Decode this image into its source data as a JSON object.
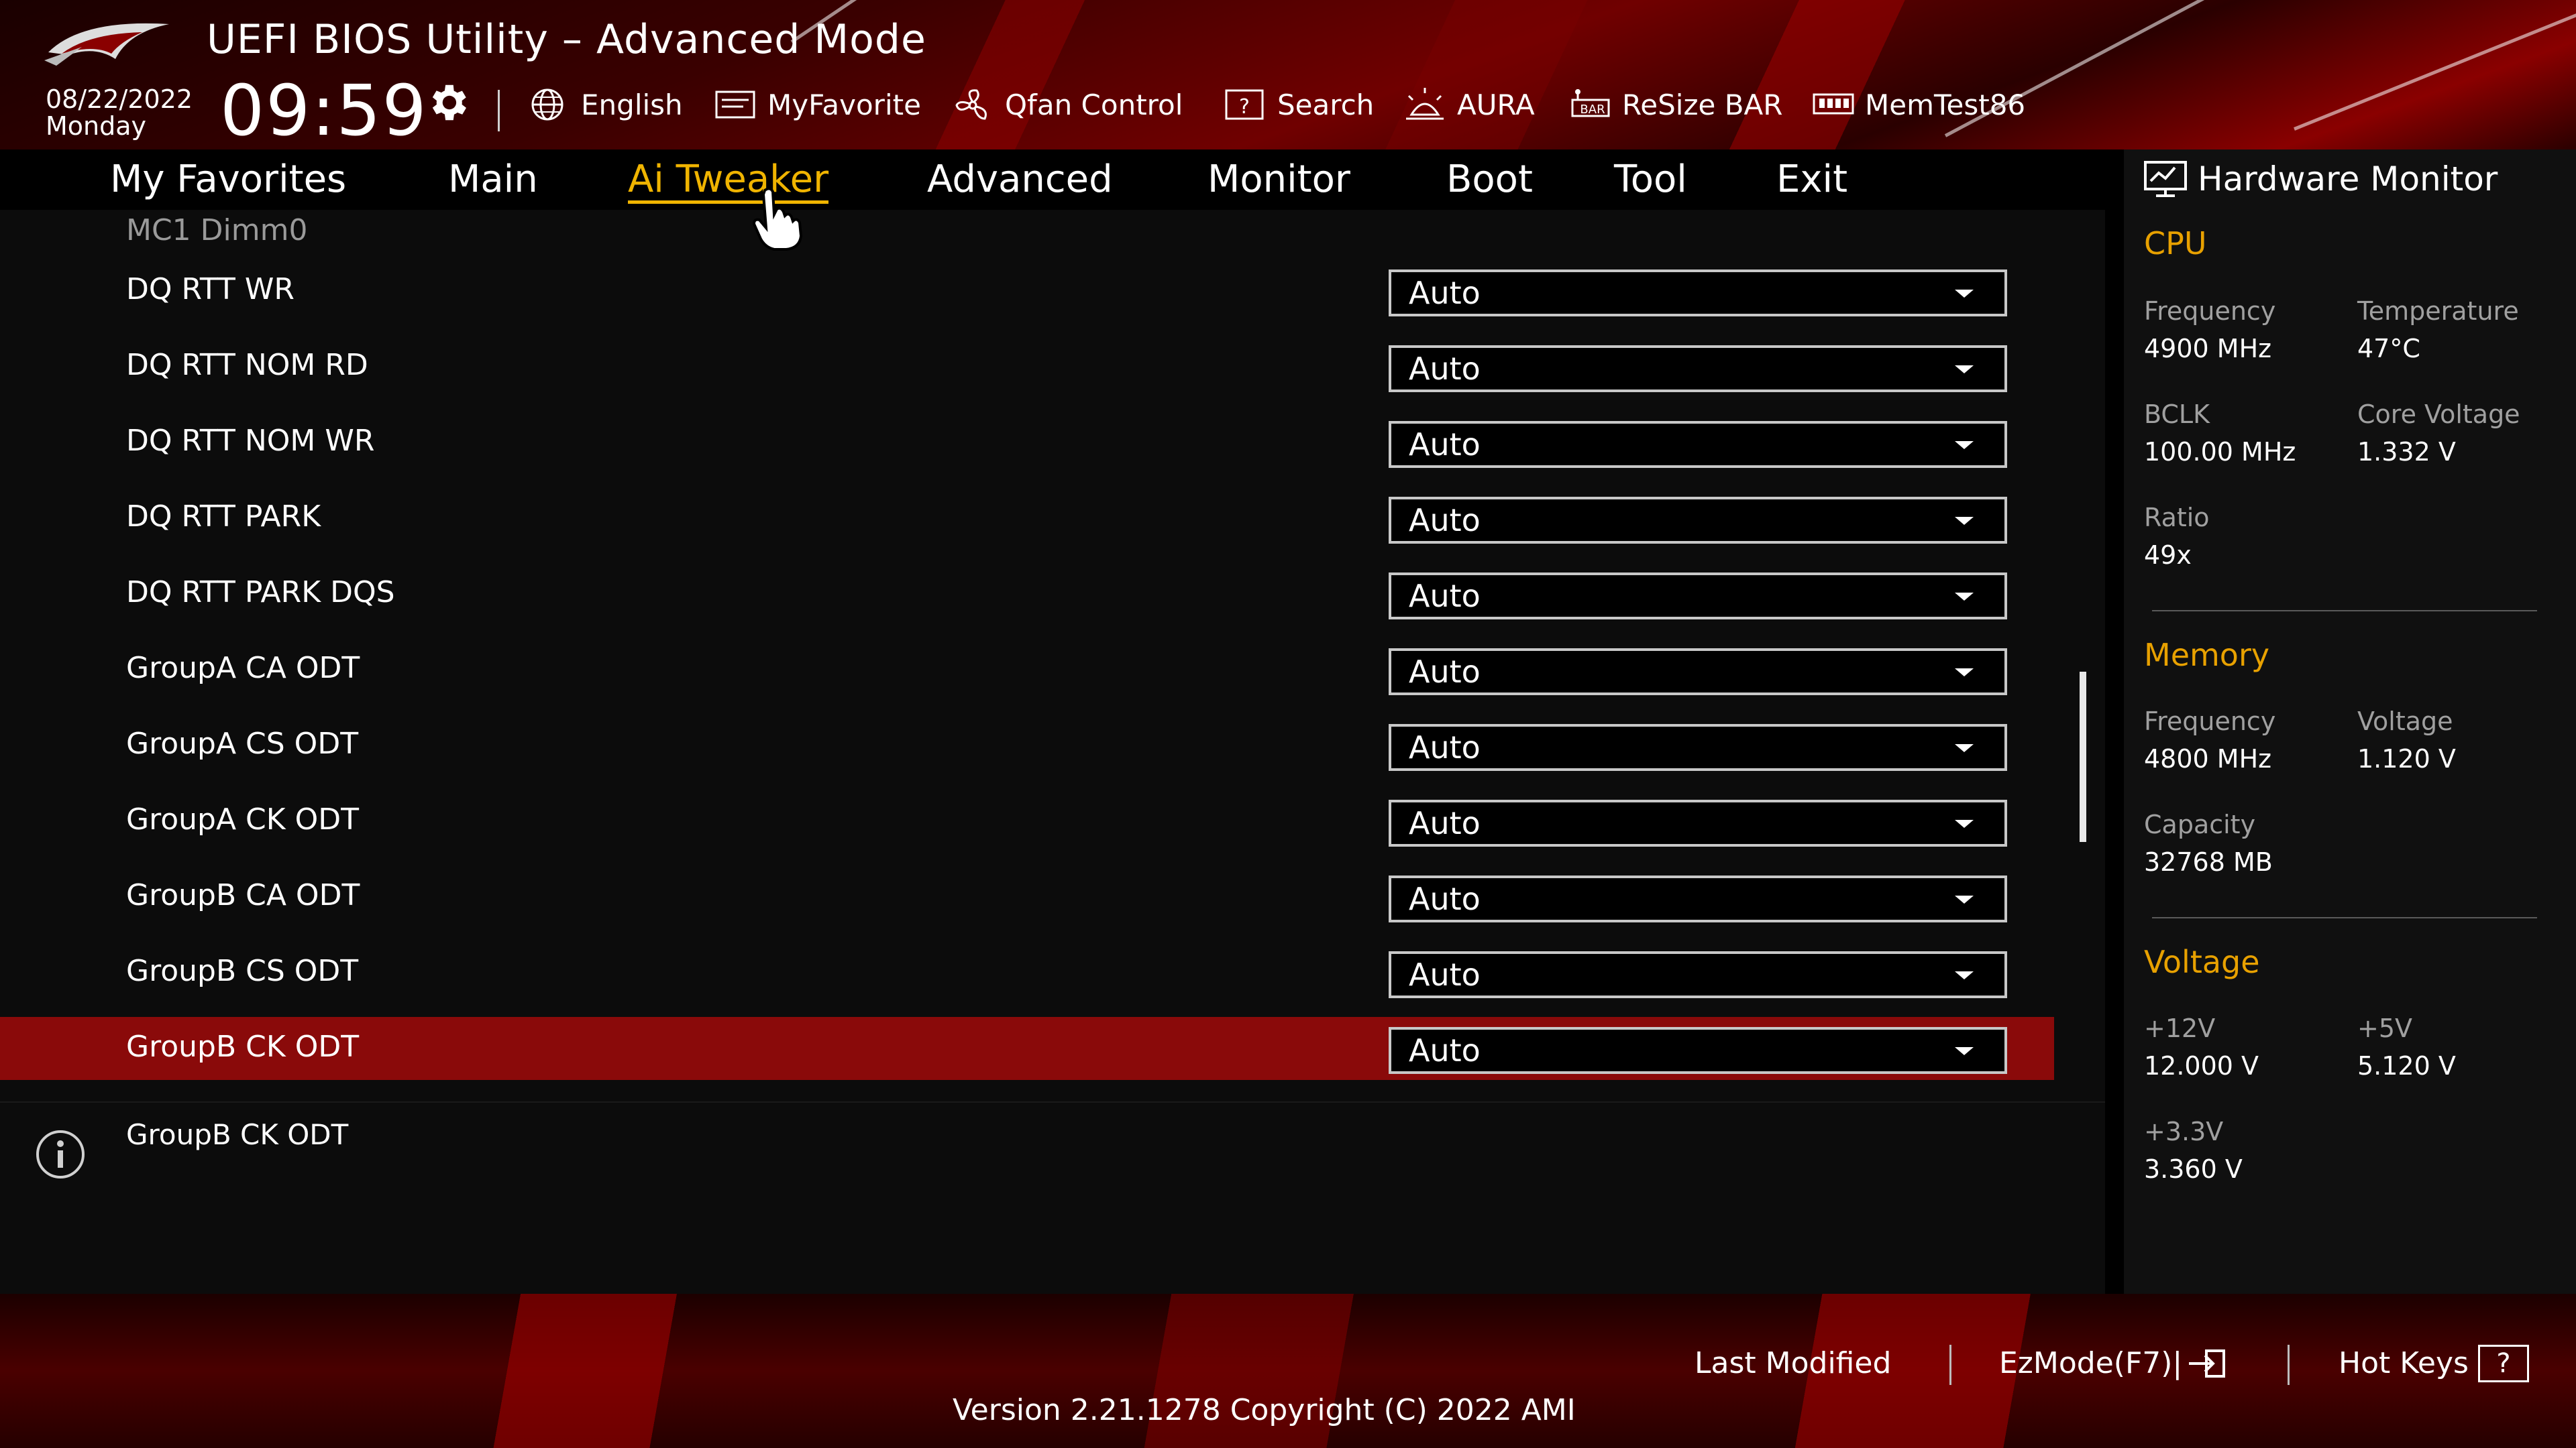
{
  "header": {
    "title": "UEFI BIOS Utility – Advanced Mode",
    "date": "08/22/2022",
    "day": "Monday",
    "time": "09:59",
    "toolbar": [
      {
        "label": "English",
        "icon": "globe-icon"
      },
      {
        "label": "MyFavorite",
        "icon": "favorite-icon"
      },
      {
        "label": "Qfan Control",
        "icon": "fan-icon"
      },
      {
        "label": "Search",
        "icon": "search-icon"
      },
      {
        "label": "AURA",
        "icon": "aura-icon"
      },
      {
        "label": "ReSize BAR",
        "icon": "resize-bar-icon"
      },
      {
        "label": "MemTest86",
        "icon": "memtest-icon"
      }
    ]
  },
  "tabs": [
    {
      "label": "My Favorites"
    },
    {
      "label": "Main"
    },
    {
      "label": "Ai Tweaker",
      "active": true
    },
    {
      "label": "Advanced"
    },
    {
      "label": "Monitor"
    },
    {
      "label": "Boot"
    },
    {
      "label": "Tool"
    },
    {
      "label": "Exit"
    }
  ],
  "main": {
    "section": "MC1 Dimm0",
    "rows": [
      {
        "label": "DQ RTT WR",
        "value": "Auto"
      },
      {
        "label": "DQ RTT NOM RD",
        "value": "Auto"
      },
      {
        "label": "DQ RTT NOM WR",
        "value": "Auto"
      },
      {
        "label": "DQ RTT PARK",
        "value": "Auto"
      },
      {
        "label": "DQ RTT PARK DQS",
        "value": "Auto"
      },
      {
        "label": "GroupA CA ODT",
        "value": "Auto"
      },
      {
        "label": "GroupA CS ODT",
        "value": "Auto"
      },
      {
        "label": "GroupA CK ODT",
        "value": "Auto"
      },
      {
        "label": "GroupB CA ODT",
        "value": "Auto"
      },
      {
        "label": "GroupB CS ODT",
        "value": "Auto"
      },
      {
        "label": "GroupB CK ODT",
        "value": "Auto",
        "selected": true
      }
    ],
    "help_text": "GroupB CK ODT"
  },
  "hardware_monitor": {
    "title": "Hardware Monitor",
    "cpu": {
      "title": "CPU",
      "frequency_label": "Frequency",
      "frequency": "4900 MHz",
      "temperature_label": "Temperature",
      "temperature": "47°C",
      "bclk_label": "BCLK",
      "bclk": "100.00 MHz",
      "core_voltage_label": "Core Voltage",
      "core_voltage": "1.332 V",
      "ratio_label": "Ratio",
      "ratio": "49x"
    },
    "memory": {
      "title": "Memory",
      "frequency_label": "Frequency",
      "frequency": "4800 MHz",
      "voltage_label": "Voltage",
      "voltage": "1.120 V",
      "capacity_label": "Capacity",
      "capacity": "32768 MB"
    },
    "voltage": {
      "title": "Voltage",
      "v12_label": "+12V",
      "v12": "12.000 V",
      "v5_label": "+5V",
      "v5": "5.120 V",
      "v33_label": "+3.3V",
      "v33": "3.360 V"
    }
  },
  "footer": {
    "last_modified": "Last Modified",
    "ezmode": "EzMode(F7)|",
    "hot_keys": "Hot Keys",
    "hot_keys_symbol": "?",
    "version": "Version 2.21.1278 Copyright (C) 2022 AMI"
  },
  "colors": {
    "accent": "#f0b400",
    "section_heading": "#e8a100",
    "highlight_row": "#8a0a0a",
    "brand_red": "#700000"
  }
}
